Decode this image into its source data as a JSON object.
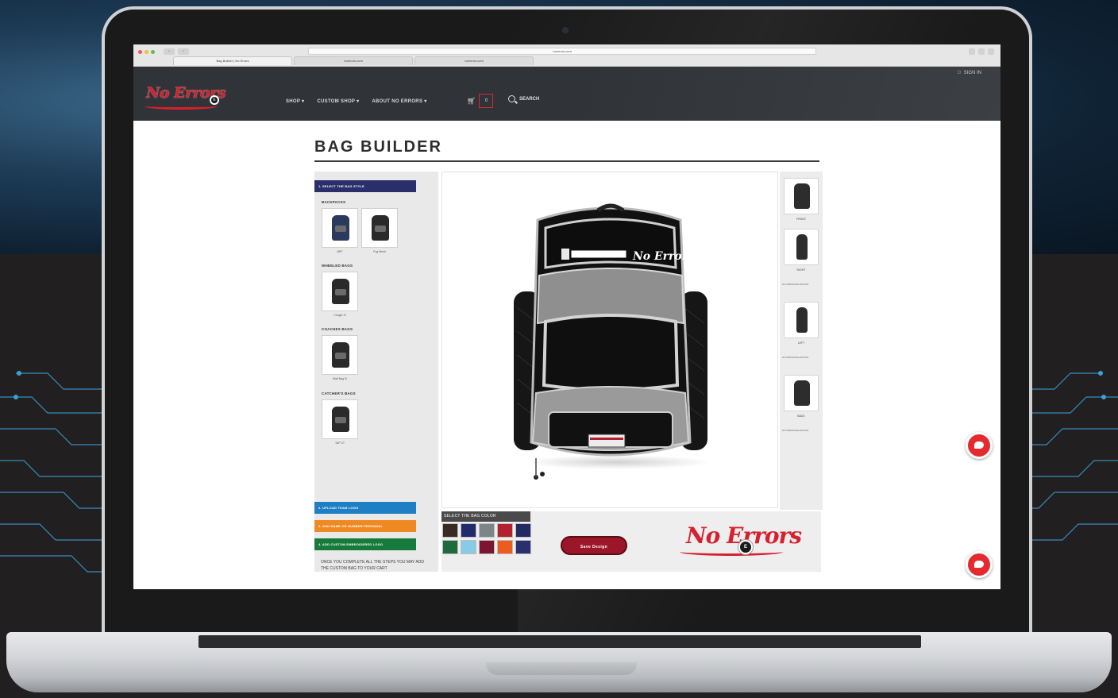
{
  "browser": {
    "url": "noerrors.com",
    "tabs": [
      "Bag Builder | No Errors",
      "noerrors.com",
      "noerrors.com"
    ],
    "nav_back": "‹",
    "nav_forward": "›"
  },
  "site": {
    "logo_text": "No Errors",
    "logo_badge": "E",
    "utility": {
      "icon": "user-icon",
      "label": "SIGN IN"
    },
    "nav": [
      {
        "label": "SHOP ▾"
      },
      {
        "label": "CUSTOM SHOP ▾"
      },
      {
        "label": "ABOUT NO ERRORS ▾"
      }
    ],
    "cart": {
      "icon": "cart-icon",
      "count": "0"
    },
    "search": {
      "icon": "search-icon",
      "label": "SEARCH"
    }
  },
  "builder": {
    "title": "BAG BUILDER",
    "steps": {
      "step1": "1. SELECT THE BAG STYLE",
      "step2": "2. UPLOAD TEAM LOGO",
      "step3": "3. ADD NAME OR NUMBER PERSONAL",
      "step4": "4. ADD CUSTOM EMBROIDERED LOGO"
    },
    "categories": {
      "backpacks": "BACKPACKS",
      "wheeled": "WHEELED BAGS",
      "coaches": "COACHES BAGS",
      "catchers": "CATCHER'S BAGS"
    },
    "products": {
      "bp1": "NEF",
      "bp2": "Fog Mesh",
      "wheeled1": "Chagin Xl",
      "coach1": "Wall Bag Xl",
      "catcher1": "TAP XT"
    },
    "note": "ONCE YOU COMPLETE ALL THE STEPS YOU MAY ADD THE CUSTOM BAG TO YOUR CART",
    "views": [
      {
        "label": "FRONT",
        "sub": ""
      },
      {
        "label": "RIGHT",
        "sub": "NO PERSONALIZATION"
      },
      {
        "label": "LEFT",
        "sub": "NO PERSONALIZATION"
      },
      {
        "label": "BACK",
        "sub": "NO PERSONALIZATION"
      }
    ],
    "color_title": "SELECT THE BAG COLOR",
    "colors": [
      "#3a2a24",
      "#1f2b6b",
      "#7c8588",
      "#b3212f",
      "#232a63",
      "#1d6a3a",
      "#87cbe6",
      "#7b1530",
      "#ec5c1e",
      "#2a2f70"
    ],
    "save_label": "Save Design",
    "bottom_logo": "No Errors",
    "bottom_badge": "E",
    "preview_logo_text": "No Errors"
  }
}
